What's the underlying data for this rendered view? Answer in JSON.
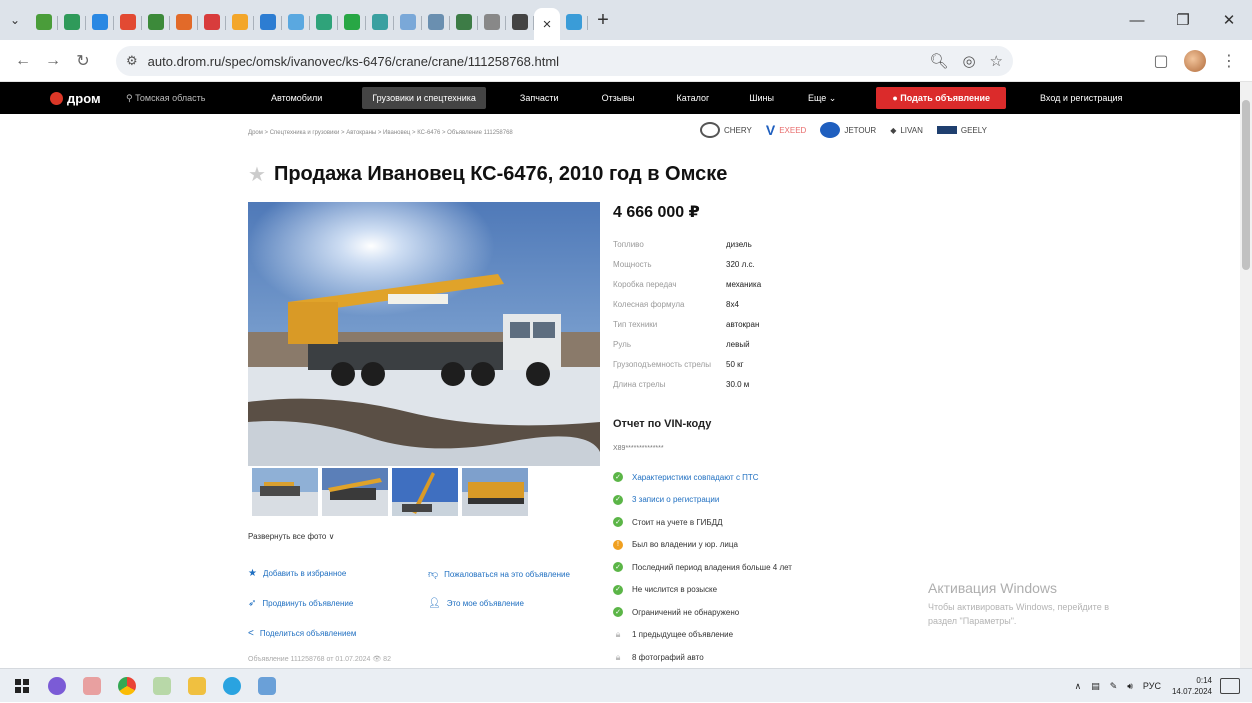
{
  "browser": {
    "tab_count": 20,
    "active_tab_index": 18,
    "tab_colors": [
      "#4a9d3a",
      "#2f9a5a",
      "#2a88e3",
      "#e24a33",
      "#3c8a3a",
      "#e26a29",
      "#d83c3c",
      "#f3a62a",
      "#2d7dd2",
      "#5aa8e0",
      "#2fa37a",
      "#28a745",
      "#3aa0a0",
      "#7aa8d8",
      "#6a8fb0",
      "#3d7c46",
      "#888",
      "#444",
      "#e5307c",
      "#3a9cd8",
      "#4285f4",
      "#e6403a",
      "#3a8bd6",
      "#e24a9f",
      "#2e8b57"
    ],
    "new_tab_icon": "+",
    "url": "auto.drom.ru/spec/omsk/ivanovec/ks-6476/crane/crane/111258768.html",
    "minimize": "—",
    "restore": "❐",
    "close": "✕"
  },
  "site_nav": {
    "logo": "дром",
    "region": "Томская область",
    "items": [
      "Автомобили",
      "Грузовики и спецтехника",
      "Запчасти",
      "Отзывы",
      "Каталог",
      "Шины",
      "Еще"
    ],
    "submit": "Подать объявление",
    "login": "Вход и регистрация"
  },
  "breadcrumb": "Дром > Спецтехника и грузовики > Автокраны > Ивановец > КС-6476 > Объявление 111258768",
  "brands": [
    "CHERY",
    "EXEED",
    "JETOUR",
    "LIVAN",
    "GEELY"
  ],
  "title": "Продажа Ивановец КС-6476, 2010 год в Омске",
  "price": "4 666 000 ₽",
  "specs": [
    {
      "label": "Топливо",
      "value": "дизель"
    },
    {
      "label": "Мощность",
      "value": "320 л.с."
    },
    {
      "label": "Коробка передач",
      "value": "механика"
    },
    {
      "label": "Колесная формула",
      "value": "8x4"
    },
    {
      "label": "Тип техники",
      "value": "автокран"
    },
    {
      "label": "Руль",
      "value": "левый"
    },
    {
      "label": "Грузоподъемность стрелы",
      "value": "50 кг"
    },
    {
      "label": "Длина стрелы",
      "value": "30.0 м"
    }
  ],
  "expand_photos": "Развернуть все фото ∨",
  "actions": {
    "favorite": "Добавить в избранное",
    "complain": "Пожаловаться на это объявление",
    "promote": "Продвинуть объявление",
    "my_ad": "Это мое объявление",
    "share": "Поделиться объявлением"
  },
  "ad_info": "Объявление 111258768 от 01.07.2024   👁 82",
  "vin": {
    "title": "Отчет по VIN-коду",
    "code": "X89**************",
    "checks": [
      {
        "text": "Характеристики совпадают с ПТС",
        "type": "ok",
        "link": true
      },
      {
        "text": "3 записи о регистрации",
        "type": "ok",
        "link": true
      },
      {
        "text": "Стоит на учете в ГИБДД",
        "type": "ok",
        "link": false
      },
      {
        "text": "Был во владении у юр. лица",
        "type": "warn",
        "link": false
      },
      {
        "text": "Последний период владения больше 4 лет",
        "type": "ok",
        "link": false
      },
      {
        "text": "Не числится в розыске",
        "type": "ok",
        "link": false
      },
      {
        "text": "Ограничений не обнаружено",
        "type": "ok",
        "link": false
      },
      {
        "text": "1 предыдущее объявление",
        "type": "lock",
        "link": false
      },
      {
        "text": "8 фотографий авто",
        "type": "lock",
        "link": false
      }
    ]
  },
  "watermark": {
    "title": "Активация Windows",
    "line1": "Чтобы активировать Windows, перейдите в",
    "line2": "раздел \"Параметры\"."
  },
  "taskbar": {
    "lang": "РУС",
    "time": "0:14",
    "date": "14.07.2024"
  }
}
